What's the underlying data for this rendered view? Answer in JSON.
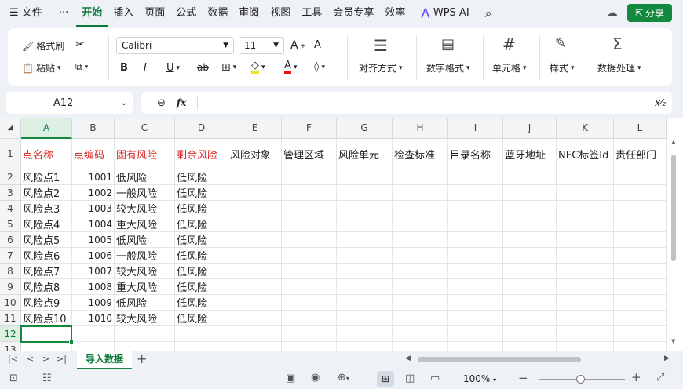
{
  "menu": {
    "file_label": "文件",
    "more": "···",
    "tabs": [
      "开始",
      "插入",
      "页面",
      "公式",
      "数据",
      "审阅",
      "视图",
      "工具",
      "会员专享",
      "效率"
    ],
    "wps_ai": "WPS AI",
    "share": "分享"
  },
  "ribbon": {
    "format_painter": "格式刷",
    "paste": "粘贴",
    "font_name": "Calibri",
    "font_size": "11",
    "bold": "B",
    "italic": "I",
    "underline": "U",
    "strike": "ab",
    "align": "对齐方式",
    "number_format": "数字格式",
    "cells": "单元格",
    "styles": "样式",
    "data_processing": "数据处理"
  },
  "formula_bar": {
    "name_box": "A12",
    "fx": "fx",
    "content": ""
  },
  "sheet": {
    "columns": [
      "A",
      "B",
      "C",
      "D",
      "E",
      "F",
      "G",
      "H",
      "I",
      "J",
      "K",
      "L"
    ],
    "rows": [
      "1",
      "2",
      "3",
      "4",
      "5",
      "6",
      "7",
      "8",
      "9",
      "10",
      "11",
      "12",
      "13"
    ],
    "headers": [
      "点名称",
      "点编码",
      "固有风险",
      "剩余风险",
      "风险对象",
      "管理区域",
      "风险单元",
      "检查标准",
      "目录名称",
      "蓝牙地址",
      "NFC标签Id",
      "责任部门"
    ],
    "data": [
      [
        "风险点1",
        "1001",
        "低风险",
        "低风险"
      ],
      [
        "风险点2",
        "1002",
        "一般风险",
        "低风险"
      ],
      [
        "风险点3",
        "1003",
        "较大风险",
        "低风险"
      ],
      [
        "风险点4",
        "1004",
        "重大风险",
        "低风险"
      ],
      [
        "风险点5",
        "1005",
        "低风险",
        "低风险"
      ],
      [
        "风险点6",
        "1006",
        "一般风险",
        "低风险"
      ],
      [
        "风险点7",
        "1007",
        "较大风险",
        "低风险"
      ],
      [
        "风险点8",
        "1008",
        "重大风险",
        "低风险"
      ],
      [
        "风险点9",
        "1009",
        "低风险",
        "低风险"
      ],
      [
        "风险点10",
        "1010",
        "较大风险",
        "低风险"
      ]
    ]
  },
  "tabs": {
    "active_sheet": "导入数据",
    "add": "+"
  },
  "status": {
    "zoom": "100%"
  },
  "colors": {
    "accent": "#12893f",
    "header_red": "#d81e1e"
  }
}
